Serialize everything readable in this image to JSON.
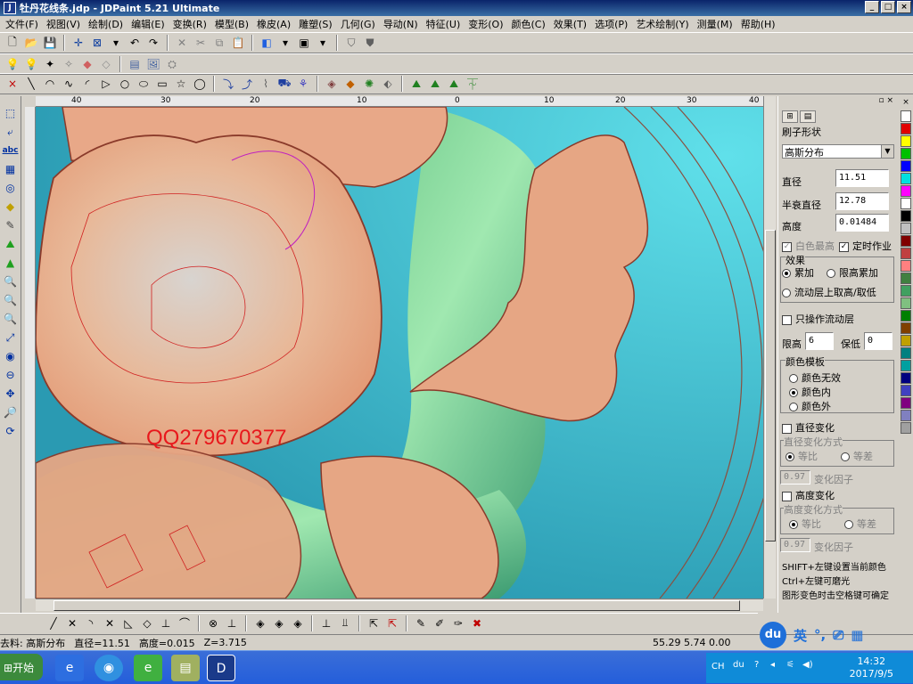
{
  "window": {
    "title": "牡丹花线条.jdp - JDPaint 5.21 Ultimate",
    "min": "_",
    "max": "□",
    "close": "×"
  },
  "menu": [
    "文件(F)",
    "视图(V)",
    "绘制(D)",
    "编辑(E)",
    "变换(R)",
    "模型(B)",
    "橡皮(A)",
    "雕塑(S)",
    "几何(G)",
    "导动(N)",
    "特征(U)",
    "变形(O)",
    "颜色(C)",
    "效果(T)",
    "选项(P)",
    "艺术绘制(Y)",
    "测量(M)",
    "帮助(H)"
  ],
  "ruler": {
    "h_labels": [
      "40",
      "30",
      "20",
      "10",
      "0",
      "10",
      "20",
      "30",
      "40"
    ]
  },
  "canvas": {
    "watermark": "QQ279670377"
  },
  "panel": {
    "title": "刷子形状",
    "brush_shape": "高斯分布",
    "diameter_label": "直径",
    "diameter": "11.51",
    "half_diameter_label": "半衰直径",
    "half_diameter": "12.78",
    "height_label": "高度",
    "height": "0.01484",
    "white_highest": "白色最高",
    "timed_op": "定时作业",
    "effect_label": "效果",
    "effect_add": "累加",
    "effect_limit": "限高累加",
    "effect_flow": "流动层上取高/取低",
    "only_flow": "只操作流动层",
    "limit_high_label": "限高",
    "limit_high": "6",
    "keep_low_label": "保低",
    "keep_low": "0",
    "color_template_label": "颜色模板",
    "color_none": "颜色无效",
    "color_inside": "颜色内",
    "color_outside": "颜色外",
    "diameter_change": "直径变化",
    "diameter_change_mode": "直径变化方式",
    "ratio": "等比",
    "diff": "等差",
    "factor1": "0.97",
    "factor_label": "变化因子",
    "height_change": "高度变化",
    "height_change_mode": "高度变化方式",
    "factor2": "0.97",
    "hint1": "SHIFT+左键设置当前颜色",
    "hint2": "Ctrl+左键可磨光",
    "hint3": "图形变色时击空格键可确定"
  },
  "palette": [
    "#ffffff",
    "#e00000",
    "#ffff00",
    "#00c000",
    "#0000ff",
    "#00e0e0",
    "#ff00ff",
    "#ffffff",
    "#000000",
    "#c0c0c0",
    "#800000",
    "#c04040",
    "#ff8080",
    "#408040",
    "#40a060",
    "#80c080",
    "#008000",
    "#804000",
    "#c0a000",
    "#008080",
    "#00a0a0",
    "#000080",
    "#4040c0",
    "#800080",
    "#8080c0",
    "#a0a0a0"
  ],
  "status": {
    "tool": "去料: 高斯分布",
    "diameter": "直径=11.51",
    "height": "高度=0.015",
    "z": "Z=3.715",
    "coords": "55.29  5.74  0.00"
  },
  "ime": {
    "du": "du",
    "lang": "英"
  },
  "taskbar": {
    "start": "开始",
    "lang": "CH",
    "time": "14:32",
    "date": "2017/9/5"
  }
}
